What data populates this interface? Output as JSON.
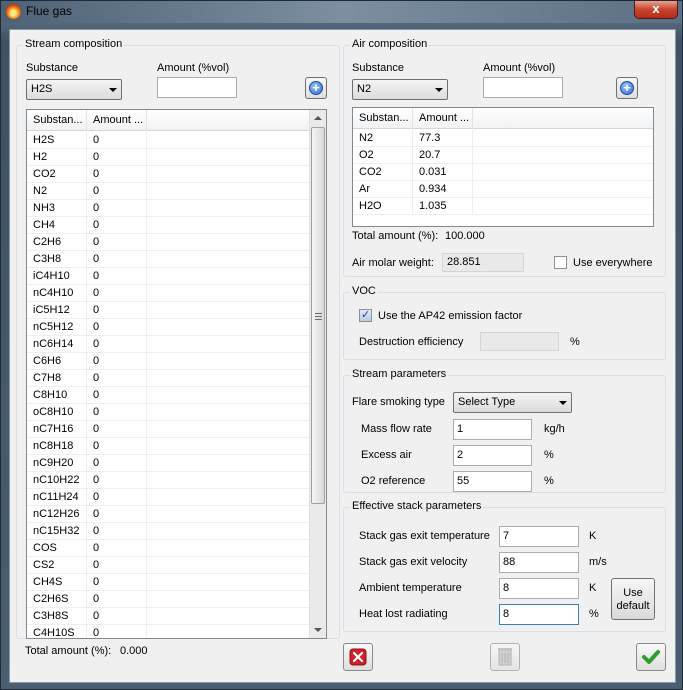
{
  "window": {
    "title": "Flue gas",
    "close_glyph": "x"
  },
  "stream_composition": {
    "group_title": "Stream composition",
    "substance_label": "Substance",
    "amount_label": "Amount (%vol)",
    "selected_substance": "H2S",
    "amount_value": "",
    "add_icon": "plus-circle-icon",
    "columns": [
      "Substan...",
      "Amount ..."
    ],
    "rows": [
      [
        "H2S",
        "0"
      ],
      [
        "H2",
        "0"
      ],
      [
        "CO2",
        "0"
      ],
      [
        "N2",
        "0"
      ],
      [
        "NH3",
        "0"
      ],
      [
        "CH4",
        "0"
      ],
      [
        "C2H6",
        "0"
      ],
      [
        "C3H8",
        "0"
      ],
      [
        "iC4H10",
        "0"
      ],
      [
        "nC4H10",
        "0"
      ],
      [
        "iC5H12",
        "0"
      ],
      [
        "nC5H12",
        "0"
      ],
      [
        "nC6H14",
        "0"
      ],
      [
        "C6H6",
        "0"
      ],
      [
        "C7H8",
        "0"
      ],
      [
        "C8H10",
        "0"
      ],
      [
        "oC8H10",
        "0"
      ],
      [
        "nC7H16",
        "0"
      ],
      [
        "nC8H18",
        "0"
      ],
      [
        "nC9H20",
        "0"
      ],
      [
        "nC10H22",
        "0"
      ],
      [
        "nC11H24",
        "0"
      ],
      [
        "nC12H26",
        "0"
      ],
      [
        "nC15H32",
        "0"
      ],
      [
        "COS",
        "0"
      ],
      [
        "CS2",
        "0"
      ],
      [
        "CH4S",
        "0"
      ],
      [
        "C2H6S",
        "0"
      ],
      [
        "C3H8S",
        "0"
      ],
      [
        "C4H10S",
        "0"
      ]
    ],
    "total_label": "Total amount (%):",
    "total_value": "0.000"
  },
  "air_composition": {
    "group_title": "Air composition",
    "substance_label": "Substance",
    "amount_label": "Amount (%vol)",
    "selected_substance": "N2",
    "amount_value": "",
    "add_icon": "plus-circle-icon",
    "columns": [
      "Substan...",
      "Amount ..."
    ],
    "rows": [
      [
        "N2",
        "77.3"
      ],
      [
        "O2",
        "20.7"
      ],
      [
        "CO2",
        "0.031"
      ],
      [
        "Ar",
        "0.934"
      ],
      [
        "H2O",
        "1.035"
      ]
    ],
    "total_label": "Total amount (%):",
    "total_value": "100.000",
    "molar_weight_label": "Air molar weight:",
    "molar_weight_value": "28.851",
    "use_everywhere_label": "Use everywhere",
    "use_everywhere_checked": false
  },
  "voc": {
    "group_title": "VOC",
    "ap42_label": "Use the AP42 emission factor",
    "ap42_checked": true,
    "destruction_label": "Destruction efficiency",
    "destruction_value": "",
    "destruction_unit": "%"
  },
  "stream_parameters": {
    "group_title": "Stream parameters",
    "smoking_label": "Flare smoking type",
    "smoking_value": "Select Type",
    "mass_flow_label": "Mass flow rate",
    "mass_flow_value": "1",
    "mass_flow_unit": "kg/h",
    "excess_air_label": "Excess air",
    "excess_air_value": "2",
    "excess_air_unit": "%",
    "o2_ref_label": "O2 reference",
    "o2_ref_value": "55",
    "o2_ref_unit": "%"
  },
  "stack_parameters": {
    "group_title": "Effective stack parameters",
    "exit_temp_label": "Stack gas exit temperature",
    "exit_temp_value": "7",
    "exit_temp_unit": "K",
    "exit_vel_label": "Stack gas exit velocity",
    "exit_vel_value": "88",
    "exit_vel_unit": "m/s",
    "ambient_label": "Ambient temperature",
    "ambient_value": "8",
    "ambient_unit": "K",
    "heat_lost_label": "Heat lost radiating",
    "heat_lost_value": "8",
    "heat_lost_unit": "%",
    "use_default_label_1": "Use",
    "use_default_label_2": "default"
  },
  "footer": {
    "cancel_icon": "red-x-icon",
    "delete_icon": "trash-icon",
    "ok_icon": "green-check-icon",
    "colors": {
      "cancel": "#d0202a",
      "ok": "#2e9e2e"
    }
  }
}
